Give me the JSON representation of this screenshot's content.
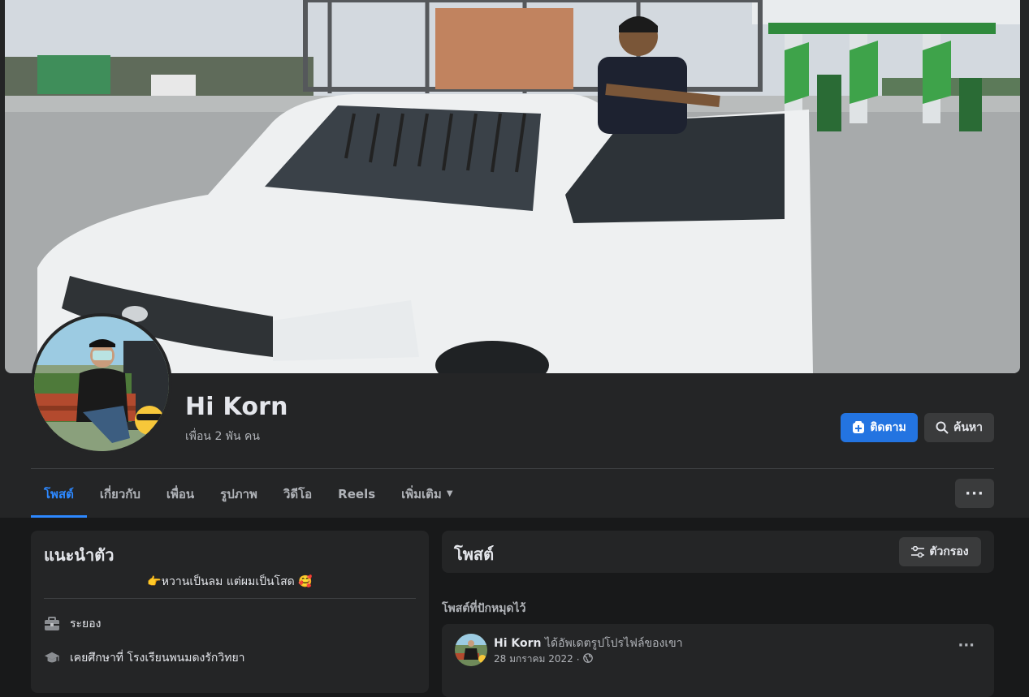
{
  "profile": {
    "name": "Hi Korn",
    "friends": "เพื่อน 2 พัน คน"
  },
  "actions": {
    "follow_label": "ติดตาม",
    "search_label": "ค้นหา",
    "more_label": "···"
  },
  "tabs": [
    {
      "label": "โพสต์",
      "active": true
    },
    {
      "label": "เกี่ยวกับ"
    },
    {
      "label": "เพื่อน"
    },
    {
      "label": "รูปภาพ"
    },
    {
      "label": "วิดีโอ"
    },
    {
      "label": "Reels"
    },
    {
      "label": "เพิ่มเติม"
    }
  ],
  "intro": {
    "title": "แนะนำตัว",
    "bio": "👉หวานเป็นลม แต่ผมเป็นโสด 🥰",
    "location": "ระยอง",
    "education": "เคยศึกษาที่ โรงเรียนพนมดงรักวิทยา"
  },
  "posts": {
    "title": "โพสต์",
    "filter_label": "ตัวกรอง",
    "pinned_label": "โพสต์ที่ปักหมุดไว้",
    "items": [
      {
        "author": "Hi Korn",
        "action": "ได้อัพเดตรูปโปรไฟล์ของเขา",
        "date": "28 มกราคม 2022",
        "separator": "·",
        "more": "···"
      }
    ]
  },
  "colors": {
    "accent": "#2d88ff",
    "button_primary": "#2374e1",
    "surface": "#242526",
    "background": "#18191a"
  }
}
